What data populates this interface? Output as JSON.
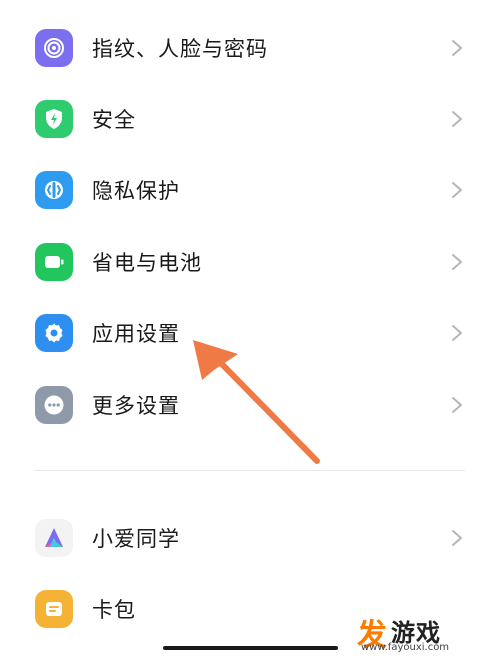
{
  "settings_list": {
    "items": [
      {
        "label": "指纹、人脸与密码",
        "icon": "fingerprint-icon",
        "color": "#7b6ff0"
      },
      {
        "label": "安全",
        "icon": "security-shield-icon",
        "color": "#2ecb6f"
      },
      {
        "label": "隐私保护",
        "icon": "privacy-icon",
        "color": "#2c9bf0"
      },
      {
        "label": "省电与电池",
        "icon": "battery-icon",
        "color": "#22c55e"
      },
      {
        "label": "应用设置",
        "icon": "gear-icon",
        "color": "#2f8ff0"
      },
      {
        "label": "更多设置",
        "icon": "more-dots-icon",
        "color": "#8e99aa"
      }
    ]
  },
  "apps_list": {
    "items": [
      {
        "label": "小爱同学",
        "icon": "xiaoai-icon",
        "color": "#ffffff"
      },
      {
        "label": "卡包",
        "icon": "card-wallet-icon",
        "color": "#f5b335"
      }
    ]
  },
  "annotation": {
    "arrow_color": "#f07a45"
  },
  "watermark": {
    "glyph": "发",
    "name": "游戏",
    "url": "www.fayouxi.com"
  }
}
